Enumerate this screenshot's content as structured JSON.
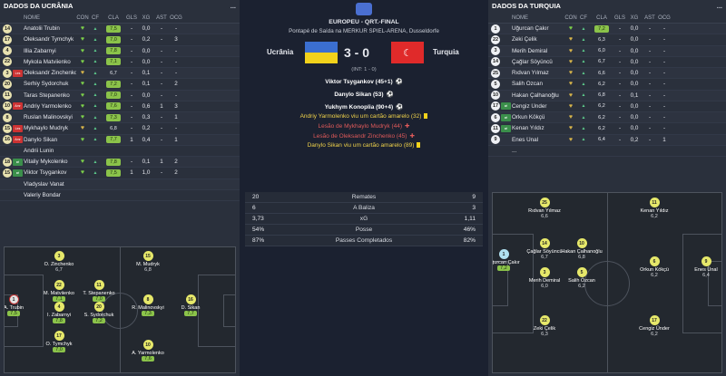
{
  "left": {
    "title": "DADOS DA UCRÂNIA",
    "menu": "...",
    "headers": {
      "name": "NOME",
      "con": "CON",
      "cf": "CF",
      "cla": "CLA",
      "gls": "GLS",
      "xg": "XG",
      "ast": "AST",
      "ocg": "OCG"
    },
    "players": [
      {
        "num": "14",
        "tag": "",
        "name": "Anatolii Trubin",
        "cla": "7,5",
        "green": true,
        "gls": "-",
        "xg": "0,0",
        "ast": "-",
        "ocg": "-"
      },
      {
        "num": "17",
        "tag": "",
        "name": "Oleksandr Tymchyk",
        "cla": "7,0",
        "green": true,
        "gls": "-",
        "xg": "0,2",
        "ast": "-",
        "ocg": "3"
      },
      {
        "num": "4",
        "tag": "",
        "name": "Illia Zabarnyi",
        "cla": "7,8",
        "green": true,
        "gls": "-",
        "xg": "0,0",
        "ast": "-",
        "ocg": "-"
      },
      {
        "num": "22",
        "tag": "",
        "name": "Mykola Matviienko",
        "cla": "7,1",
        "green": true,
        "gls": "-",
        "xg": "0,0",
        "ast": "-",
        "ocg": "-"
      },
      {
        "num": "3",
        "tag": "Les",
        "name": "Oleksandr Zinchenko",
        "cla": "6,7",
        "green": false,
        "gls": "-",
        "xg": "0,1",
        "ast": "-",
        "ocg": "-"
      },
      {
        "num": "20",
        "tag": "",
        "name": "Serhiy Sydorchuk",
        "cla": "7,2",
        "green": true,
        "gls": "-",
        "xg": "0,1",
        "ast": "-",
        "ocg": "2"
      },
      {
        "num": "11",
        "tag": "",
        "name": "Taras Stepanenko",
        "cla": "7,0",
        "green": true,
        "gls": "-",
        "xg": "0,0",
        "ast": "-",
        "ocg": "-"
      },
      {
        "num": "10",
        "tag": "Amr",
        "name": "Andriy Yarmolenko",
        "cla": "7,6",
        "green": true,
        "gls": "-",
        "xg": "0,6",
        "ast": "1",
        "ocg": "3"
      },
      {
        "num": "8",
        "tag": "",
        "name": "Ruslan Malinovskyi",
        "cla": "7,3",
        "green": true,
        "gls": "-",
        "xg": "0,3",
        "ast": "-",
        "ocg": "1"
      },
      {
        "num": "15",
        "tag": "Les",
        "name": "Mykhaylo Mudryk",
        "cla": "6,8",
        "green": false,
        "gls": "-",
        "xg": "0,2",
        "ast": "-",
        "ocg": "-"
      },
      {
        "num": "16",
        "tag": "Amr",
        "name": "Danylo Sikan",
        "cla": "7,7",
        "green": true,
        "gls": "1",
        "xg": "0,4",
        "ast": "-",
        "ocg": "1"
      },
      {
        "num": "",
        "tag": "",
        "name": "Andrii Lunin",
        "cla": "",
        "green": false,
        "gls": "",
        "xg": "",
        "ast": "",
        "ocg": ""
      },
      {
        "num": "18",
        "tag": "sub",
        "name": "Vitaliy Mykolenko",
        "cla": "7,8",
        "green": true,
        "gls": "-",
        "xg": "0,1",
        "ast": "1",
        "ocg": "2"
      },
      {
        "num": "15",
        "tag": "sub",
        "name": "Viktor Tsygankov",
        "cla": "7,5",
        "green": true,
        "gls": "1",
        "xg": "1,0",
        "ast": "-",
        "ocg": "2"
      },
      {
        "num": "",
        "tag": "",
        "name": "Vladyslav Vanat",
        "cla": "",
        "green": false,
        "gls": "",
        "xg": "",
        "ast": "",
        "ocg": ""
      },
      {
        "num": "",
        "tag": "",
        "name": "Valeriy Bondar",
        "cla": "",
        "green": false,
        "gls": "",
        "xg": "",
        "ast": "",
        "ocg": ""
      }
    ],
    "pitch": [
      {
        "name": "A. Trubin",
        "num": "1",
        "rating": "7,5",
        "red": true,
        "green": true
      },
      {
        "name": "O. Zinchenko",
        "num": "3",
        "rating": "6,7"
      },
      {
        "name": "M. Matviienko",
        "num": "22",
        "rating": "7,1",
        "green": true
      },
      {
        "name": "I. Zabarnyi",
        "num": "4",
        "rating": "7,8",
        "green": true
      },
      {
        "name": "O. Tymchyk",
        "num": "17",
        "rating": "7,0",
        "green": true
      },
      {
        "name": "T. Stepanenko",
        "num": "11",
        "rating": "7,0",
        "green": true
      },
      {
        "name": "S. Sydorchuk",
        "num": "20",
        "rating": "7,2",
        "green": true
      },
      {
        "name": "M. Mudryk",
        "num": "15",
        "rating": "6,8"
      },
      {
        "name": "R. Malinovskyi",
        "num": "8",
        "rating": "7,3",
        "green": true
      },
      {
        "name": "A. Yarmolenko",
        "num": "10",
        "rating": "7,6",
        "green": true
      },
      {
        "name": "D. Sikan",
        "num": "16",
        "rating": "7,7",
        "green": true
      }
    ]
  },
  "center": {
    "competition": "EUROPEU - QRT.-FINAL",
    "venue": "Pontapé de Saída na MERKUR SPIEL-ARENA, Dusseldorfe",
    "home": "Ucrânia",
    "away": "Turquia",
    "score": "3 - 0",
    "interval": "(INT: 1 - 0)",
    "events": [
      {
        "text": "Viktor Tsygankov (45+1)",
        "type": "goal"
      },
      {
        "text": "Danylo Sikan (53)",
        "type": "goal"
      },
      {
        "text": "Yukhym Konoplia (90+4)",
        "type": "goal"
      },
      {
        "text": "Andriy Yarmolenko viu um cartão amarelo (32)",
        "type": "yellow"
      },
      {
        "text": "Lesão de Mykhaylo Mudryk (44)",
        "type": "injury"
      },
      {
        "text": "Lesão de Oleksandr Zinchenko (45)",
        "type": "injury"
      },
      {
        "text": "Danylo Sikan viu um cartão amarelo (89)",
        "type": "yellow"
      }
    ],
    "stats": [
      {
        "home": "20",
        "label": "Remates",
        "away": "9"
      },
      {
        "home": "6",
        "label": "A Baliza",
        "away": "3"
      },
      {
        "home": "3,73",
        "label": "xG",
        "away": "1,11"
      },
      {
        "home": "54%",
        "label": "Posse",
        "away": "46%"
      },
      {
        "home": "87%",
        "label": "Passes Completados",
        "away": "82%"
      }
    ]
  },
  "right": {
    "title": "DADOS DA TURQUIA",
    "menu": "...",
    "headers": {
      "name": "NOME",
      "con": "CON",
      "cf": "CF",
      "cla": "CLA",
      "gls": "GLS",
      "xg": "XG",
      "ast": "AST",
      "ocg": "OCG"
    },
    "players": [
      {
        "num": "1",
        "tag": "",
        "name": "Uğurcan Çakır",
        "cla": "7,2",
        "green": true,
        "gls": "-",
        "xg": "0,0",
        "ast": "-",
        "ocg": "-"
      },
      {
        "num": "22",
        "tag": "",
        "name": "Zeki Çelik",
        "cla": "6,3",
        "green": false,
        "gls": "-",
        "xg": "0,0",
        "ast": "-",
        "ocg": "-"
      },
      {
        "num": "3",
        "tag": "",
        "name": "Merih Demiral",
        "cla": "6,0",
        "green": false,
        "gls": "-",
        "xg": "0,0",
        "ast": "-",
        "ocg": "-"
      },
      {
        "num": "14",
        "tag": "",
        "name": "Çağlar Söyüncü",
        "cla": "6,7",
        "green": false,
        "gls": "-",
        "xg": "0,0",
        "ast": "-",
        "ocg": "-"
      },
      {
        "num": "25",
        "tag": "",
        "name": "Rıdvan Yılmaz",
        "cla": "6,6",
        "green": false,
        "gls": "-",
        "xg": "0,0",
        "ast": "-",
        "ocg": "-"
      },
      {
        "num": "5",
        "tag": "",
        "name": "Salih Özcan",
        "cla": "6,2",
        "green": false,
        "gls": "-",
        "xg": "0,0",
        "ast": "-",
        "ocg": "-"
      },
      {
        "num": "10",
        "tag": "",
        "name": "Hakan Çalhanoğlu",
        "cla": "6,8",
        "green": false,
        "gls": "-",
        "xg": "0,1",
        "ast": "-",
        "ocg": "-"
      },
      {
        "num": "17",
        "tag": "sub",
        "name": "Cengiz Ünder",
        "cla": "6,2",
        "green": false,
        "gls": "-",
        "xg": "0,0",
        "ast": "-",
        "ocg": "-"
      },
      {
        "num": "6",
        "tag": "sub",
        "name": "Orkun Kökçü",
        "cla": "6,2",
        "green": false,
        "gls": "-",
        "xg": "0,0",
        "ast": "-",
        "ocg": "-"
      },
      {
        "num": "11",
        "tag": "sub",
        "name": "Kenan Yıldız",
        "cla": "6,2",
        "green": false,
        "gls": "-",
        "xg": "0,0",
        "ast": "-",
        "ocg": "-"
      },
      {
        "num": "9",
        "tag": "",
        "name": "Enes Ünal",
        "cla": "6,4",
        "green": false,
        "gls": "-",
        "xg": "0,2",
        "ast": "-",
        "ocg": "1"
      },
      {
        "num": "",
        "tag": "",
        "name": "...",
        "cla": "",
        "green": false,
        "gls": "",
        "xg": "",
        "ast": "",
        "ocg": ""
      }
    ],
    "pitch": [
      {
        "name": "Uğurcan Çakır",
        "num": "1",
        "rating": "7,2",
        "green": true
      },
      {
        "name": "Rıdvan Yılmaz",
        "num": "25",
        "rating": "6,6"
      },
      {
        "name": "Çağlar Söyüncü",
        "num": "14",
        "rating": "6,7"
      },
      {
        "name": "Hakan Çalhanoğlu",
        "num": "10",
        "rating": "6,8"
      },
      {
        "name": "Merih Demiral",
        "num": "3",
        "rating": "6,0"
      },
      {
        "name": "Salih Özcan",
        "num": "5",
        "rating": "6,2"
      },
      {
        "name": "Zeki Çelik",
        "num": "22",
        "rating": "6,3"
      },
      {
        "name": "Kenan Yıldız",
        "num": "11",
        "rating": "6,2"
      },
      {
        "name": "Orkun Kökçü",
        "num": "6",
        "rating": "6,2"
      },
      {
        "name": "Cengiz Ünder",
        "num": "17",
        "rating": "6,2"
      },
      {
        "name": "Enes Ünal",
        "num": "9",
        "rating": "6,4"
      }
    ]
  }
}
